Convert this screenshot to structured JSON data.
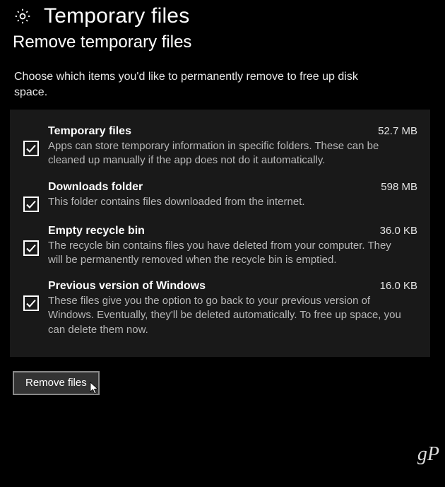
{
  "header": {
    "title": "Temporary files",
    "subtitle": "Remove temporary files",
    "instructions": "Choose which items you'd like to permanently remove to free up disk space."
  },
  "items": [
    {
      "title": "Temporary files",
      "size": "52.7 MB",
      "desc": "Apps can store temporary information in specific folders. These can be cleaned up manually if the app does not do it automatically.",
      "checked": true
    },
    {
      "title": "Downloads folder",
      "size": "598 MB",
      "desc": "This folder contains files downloaded from the internet.",
      "checked": true
    },
    {
      "title": "Empty recycle bin",
      "size": "36.0 KB",
      "desc": "The recycle bin contains files you have deleted from your computer. They will be permanently removed when the recycle bin is emptied.",
      "checked": true
    },
    {
      "title": "Previous version of Windows",
      "size": "16.0 KB",
      "desc": "These files give you the option to go back to your previous version of Windows. Eventually, they'll be deleted automatically. To free up space, you can delete them now.",
      "checked": true
    }
  ],
  "actions": {
    "remove_label": "Remove files"
  },
  "watermark": "gP"
}
